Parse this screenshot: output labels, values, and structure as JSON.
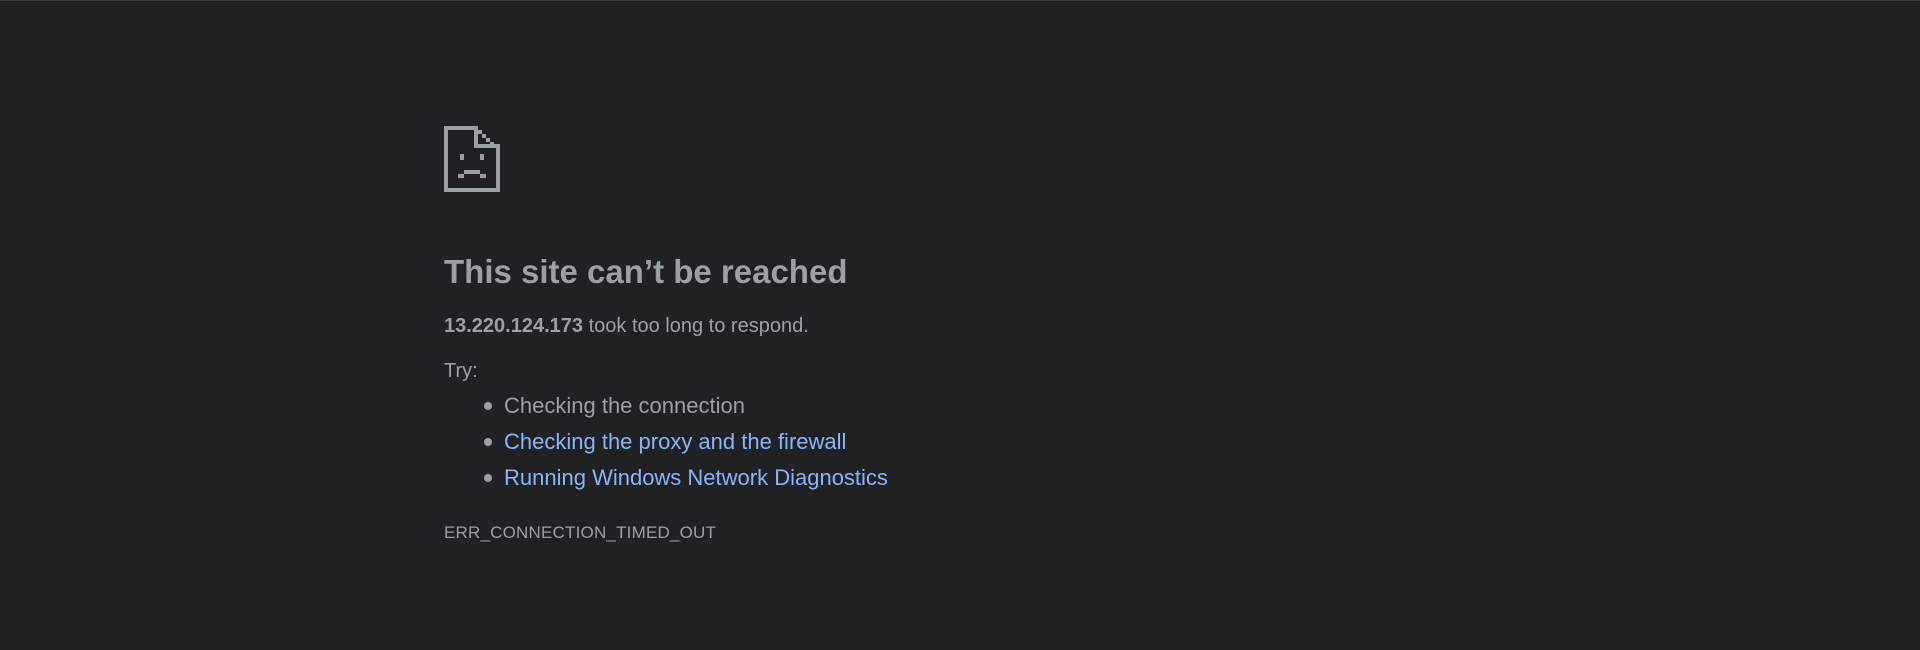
{
  "error_page": {
    "icon": "sad-page-icon",
    "title": "This site can’t be reached",
    "host": "13.220.124.173",
    "message_suffix": " took too long to respond.",
    "try_label": "Try:",
    "suggestions": [
      {
        "label": "Checking the connection",
        "is_link": false
      },
      {
        "label": "Checking the proxy and the firewall",
        "is_link": true
      },
      {
        "label": "Running Windows Network Diagnostics",
        "is_link": true
      }
    ],
    "error_code": "ERR_CONNECTION_TIMED_OUT"
  },
  "colors": {
    "background": "#202124",
    "text": "#9aa0a6",
    "link": "#8ab4f8"
  }
}
